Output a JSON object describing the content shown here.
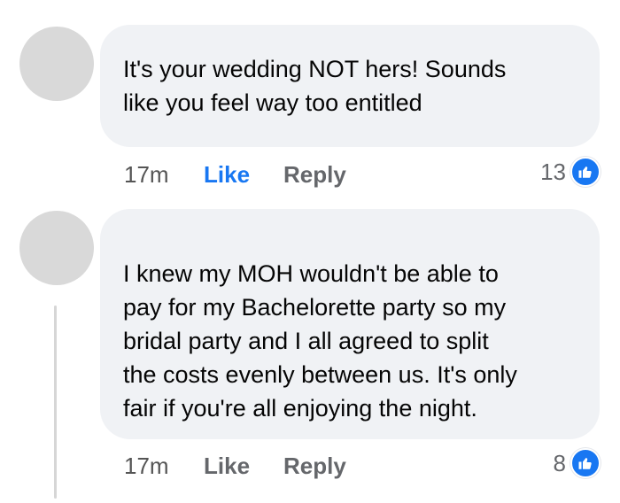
{
  "comments": [
    {
      "text_lines": [
        "It's your wedding NOT hers! Sounds",
        "like you feel way too entitled"
      ],
      "time": "17m",
      "like_label": "Like",
      "reply_label": "Reply",
      "reaction_count": "13",
      "like_active": true
    },
    {
      "text_lines": [
        "I knew my MOH wouldn't be able to",
        "pay for my Bachelorette party so my",
        "bridal party and I all agreed to split",
        "the costs evenly between us. It's only",
        "fair if you're all enjoying the night."
      ],
      "time": "17m",
      "like_label": "Like",
      "reply_label": "Reply",
      "reaction_count": "8",
      "like_active": false
    }
  ],
  "icons": {
    "reaction": "thumbs-up-icon",
    "avatar": "avatar-placeholder"
  },
  "colors": {
    "bubble_bg": "#f0f2f5",
    "like_active": "#1877f2",
    "secondary_text": "#65676b",
    "avatar": "#d9d9d9"
  }
}
